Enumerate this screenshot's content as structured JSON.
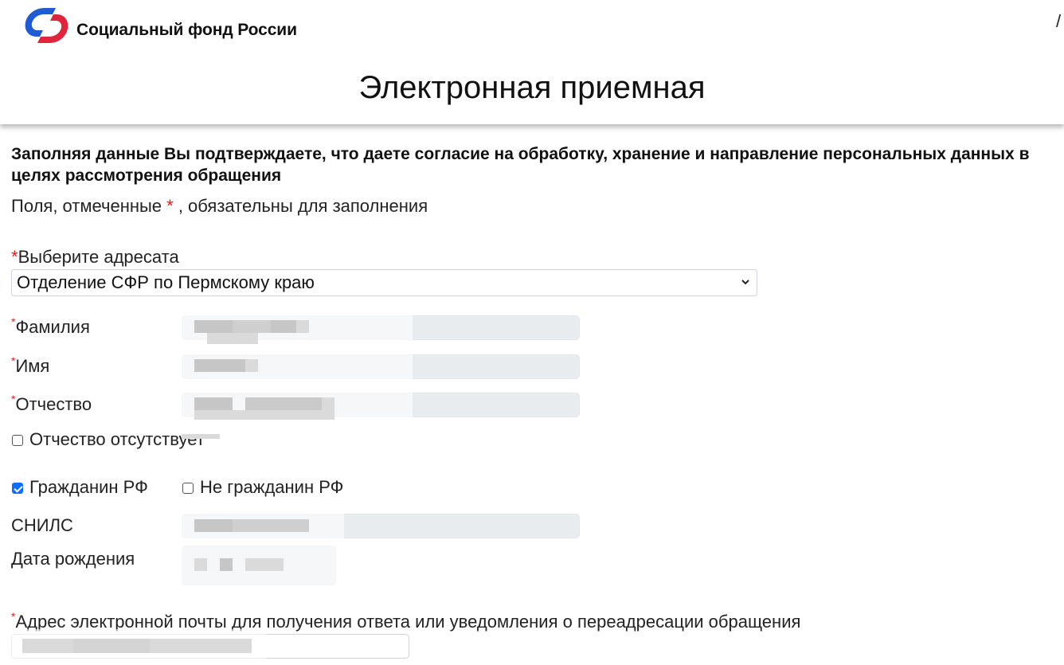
{
  "header": {
    "brand_name": "Социальный фонд России",
    "title": "Электронная приемная",
    "corner_glyph": "/",
    "logo_colors": {
      "blue": "#1f5bd6",
      "red": "#e0243b"
    }
  },
  "intro": {
    "consent_text": "Заполняя данные Вы подтверждаете, что даете согласие на обработку, хранение и направление персональных данных в целях рассмотрения обращения",
    "required_prefix": "Поля, отмеченные ",
    "required_star": "*",
    "required_suffix": " , обязательны для заполнения"
  },
  "form": {
    "addressee": {
      "label": "Выберите адресата",
      "selected": "Отделение СФР по Пермскому краю"
    },
    "last_name": {
      "label": "Фамилия",
      "value": ""
    },
    "first_name": {
      "label": "Имя",
      "value": ""
    },
    "middle_name": {
      "label": "Отчество",
      "value": ""
    },
    "no_middle_name": {
      "label": "Отчество отсутствует",
      "checked": false
    },
    "citizen_rf": {
      "label": "Гражданин РФ",
      "checked": true
    },
    "not_citizen_rf": {
      "label": "Не гражданин РФ",
      "checked": false
    },
    "snils": {
      "label": "СНИЛС",
      "value": ""
    },
    "birth_date": {
      "label": "Дата рождения",
      "value": ""
    },
    "email": {
      "label": "Адрес электронной почты для получения ответа или уведомления о переадресации обращения",
      "value": ""
    },
    "required_mark": "*"
  },
  "colors": {
    "required_star": "#e11d1d",
    "checkbox_checked": "#0d6efd",
    "readonly_field_bg": "#e9ecef"
  }
}
